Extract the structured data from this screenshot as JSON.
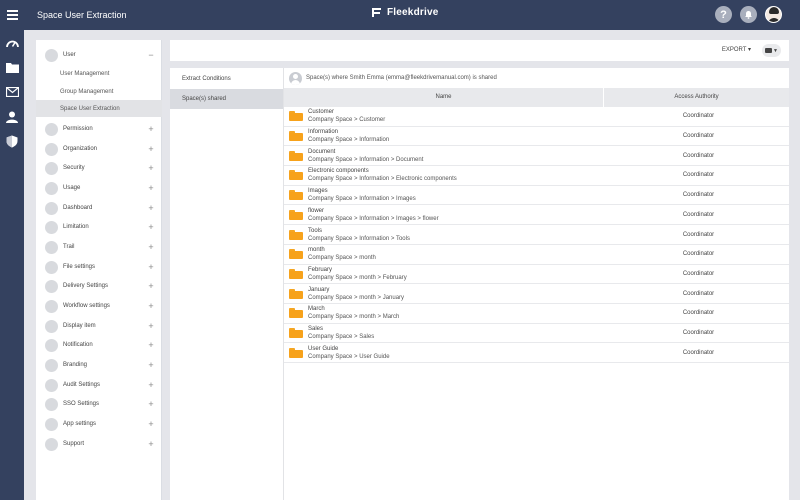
{
  "app": {
    "title": "Space User Extraction",
    "brand": "Fleekdrive"
  },
  "header_icons": [
    "help-icon",
    "notification-bell-icon",
    "user-avatar"
  ],
  "rail_icons": [
    "dashboard-gauge-icon",
    "folder-icon",
    "mail-icon",
    "user-icon",
    "shield-icon"
  ],
  "sidebar": {
    "user": {
      "label": "User",
      "toggle": "−"
    },
    "sub_items": [
      {
        "label": "User Management"
      },
      {
        "label": "Group Management"
      },
      {
        "label": "Space User Extraction"
      }
    ],
    "items": [
      {
        "label": "Permission",
        "toggle": "+"
      },
      {
        "label": "Organization",
        "toggle": "+"
      },
      {
        "label": "Security",
        "toggle": "+"
      },
      {
        "label": "Usage",
        "toggle": "+"
      },
      {
        "label": "Dashboard",
        "toggle": "+"
      },
      {
        "label": "Limitation",
        "toggle": "+"
      },
      {
        "label": "Trail",
        "toggle": "+"
      },
      {
        "label": "File settings",
        "toggle": "+"
      },
      {
        "label": "Delivery Settings",
        "toggle": "+"
      },
      {
        "label": "Workflow settings",
        "toggle": "+"
      },
      {
        "label": "Display item",
        "toggle": "+"
      },
      {
        "label": "Notification",
        "toggle": "+"
      },
      {
        "label": "Branding",
        "toggle": "+"
      },
      {
        "label": "Audit Settings",
        "toggle": "+"
      },
      {
        "label": "SSO Settings",
        "toggle": "+"
      },
      {
        "label": "App settings",
        "toggle": "+"
      },
      {
        "label": "Support",
        "toggle": "+"
      }
    ]
  },
  "toolbar": {
    "export_label": "EXPORT ▾"
  },
  "tabs": [
    {
      "label": "Extract Conditions"
    },
    {
      "label": "Space(s) shared"
    }
  ],
  "content": {
    "header_text": "Space(s) where Smith Emma (emma@fleekdrivemanual.com) is shared",
    "columns": {
      "name": "Name",
      "access": "Access Authority"
    },
    "rows": [
      {
        "name": "Customer",
        "path": "Company Space > Customer",
        "access": "Coordinator"
      },
      {
        "name": "Information",
        "path": "Company Space > Information",
        "access": "Coordinator"
      },
      {
        "name": "Document",
        "path": "Company Space > Information > Document",
        "access": "Coordinator"
      },
      {
        "name": "Electronic components",
        "path": "Company Space > Information > Electronic components",
        "access": "Coordinator"
      },
      {
        "name": "Images",
        "path": "Company Space > Information > Images",
        "access": "Coordinator"
      },
      {
        "name": "flower",
        "path": "Company Space > Information > Images > flower",
        "access": "Coordinator"
      },
      {
        "name": "Tools",
        "path": "Company Space > Information > Tools",
        "access": "Coordinator"
      },
      {
        "name": "month",
        "path": "Company Space > month",
        "access": "Coordinator"
      },
      {
        "name": "February",
        "path": "Company Space > month > February",
        "access": "Coordinator"
      },
      {
        "name": "January",
        "path": "Company Space > month > January",
        "access": "Coordinator"
      },
      {
        "name": "March",
        "path": "Company Space > month > March",
        "access": "Coordinator"
      },
      {
        "name": "Sales",
        "path": "Company Space > Sales",
        "access": "Coordinator"
      },
      {
        "name": "User Guide",
        "path": "Company Space > User Guide",
        "access": "Coordinator"
      }
    ]
  }
}
